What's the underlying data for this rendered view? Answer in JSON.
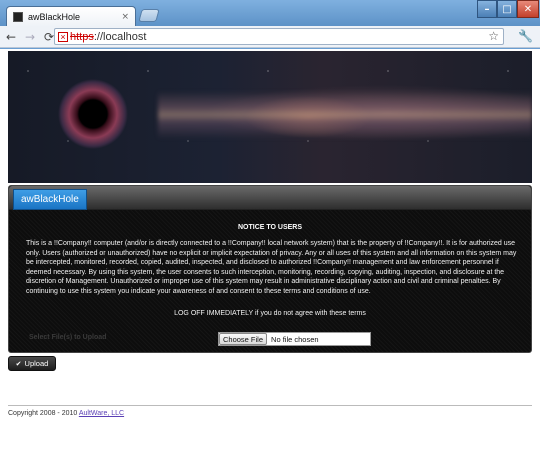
{
  "browser": {
    "tab_title": "awBlackHole",
    "tab_close": "×",
    "url_scheme": "https",
    "url_rest": "://localhost",
    "window_controls": {
      "minimize": "–",
      "maximize": "□",
      "close": "✕"
    }
  },
  "app": {
    "tab_label": "awBlackHole",
    "notice_title": "NOTICE TO USERS",
    "notice_body": "This is a !!Company!! computer (and/or is directly connected to a !!Company!! local network system) that is the property of !!Company!!. It is for authorized use only. Users (authorized or unauthorized) have no explicit or implicit expectation of privacy. Any or all uses of this system and all information on this system may be intercepted, monitored, recorded, copied, audited, inspected, and disclosed to authorized !!Company!! management and law enforcement personnel if deemed necessary. By using this system, the user consents to such interception, monitoring, recording, copying, auditing, inspection, and disclosure at the discretion of Management. Unauthorized or improper use of this system may result in administrative disciplinary action and civil and criminal penalties. By continuing to use this system you indicate your awareness of and consent to these terms and conditions of use.",
    "logoff": "LOG OFF IMMEDIATELY if you do not agree with these terms",
    "select_label": "Select File(s) to Upload",
    "choose_file": "Choose File",
    "file_status": "No file chosen",
    "upload_label": "Upload"
  },
  "footer": {
    "copyright": "Copyright 2008 - 2010 ",
    "company_link": "AultWare, LLC"
  },
  "icons": [
    "favicon-icon",
    "close-icon",
    "back-icon",
    "forward-icon",
    "reload-icon",
    "insecure-https-icon",
    "star-icon",
    "wrench-icon",
    "check-icon"
  ]
}
